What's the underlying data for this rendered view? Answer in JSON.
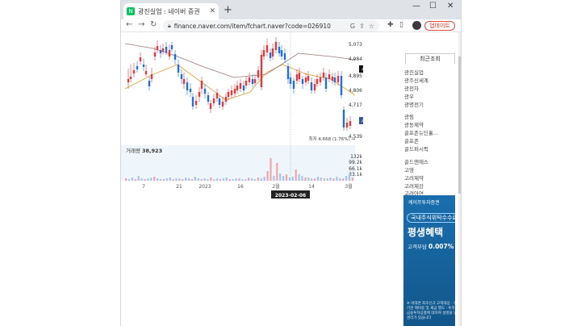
{
  "browser": {
    "tab_title": "광진실업 : 네이버 증권",
    "favicon_glyph": "N",
    "new_tab_icon": "plus-icon",
    "url": "finance.naver.com/item/fchart.naver?code=026910",
    "update_label": "업데이트"
  },
  "chart": {
    "price_labels": [
      "5,073",
      "4,984",
      "4,936",
      "4,895",
      "4,806",
      "4,717",
      "4,635",
      "4,539"
    ],
    "current_price_tag": "4,936",
    "last_price_tag": "4,635",
    "low_annotation": "최저 4,668 (1.76%) →",
    "volume_label": "거래량",
    "volume_value": "38,923",
    "volume_ticks": [
      "132k",
      "99.2k",
      "66.1k",
      "33.1k"
    ],
    "x_labels": [
      "7",
      "21",
      "2023",
      "16",
      "2월",
      "14",
      "3월"
    ],
    "crosshair_date": "2023-02-06",
    "colors": {
      "up": "#e5383b",
      "down": "#1f6fe0",
      "ma_short": "#d9a230",
      "ma_long": "#9b7a7a"
    }
  },
  "sidebar": {
    "tab_label": "최근조회",
    "items": [
      "광진실업",
      "광주신세계",
      "광전자",
      "광우",
      "광명전기"
    ],
    "items2": [
      "광림",
      "광동제약",
      "골프존뉴딘홀...",
      "골프존",
      "골드퍼시픽"
    ],
    "items3": [
      "골드앤에스",
      "고영",
      "고려제약",
      "고려제강",
      "고려아연"
    ],
    "pager": [
      "‹",
      "›"
    ]
  },
  "ad": {
    "logo": "케이프투자증권",
    "pill": "국내주식위탁수수료",
    "headline": "평생혜택",
    "rate_prefix": "고객부담",
    "rate": "0.007%",
    "note": "※ 비대면 최초신규 고객대상 · 유관기관 제비용 및 세금 별도 · 투자자는 금융투자상품에 대하여 설명을 받을 권리가 있습니다"
  }
}
